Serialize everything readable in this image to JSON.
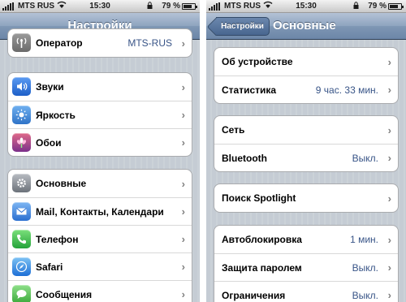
{
  "colors": {
    "value_text": "#385487",
    "nav_bar": "#6c86a8",
    "background": "#c5ccd4"
  },
  "left_screen": {
    "status": {
      "carrier": "MTS RUS",
      "time": "15:30",
      "battery": "79 %",
      "battery_level": 0.79
    },
    "nav": {
      "title": "Настройки"
    },
    "groups": [
      {
        "rows": [
          {
            "icon": "antenna-icon",
            "label": "Оператор",
            "value": "MTS-RUS"
          }
        ]
      },
      {
        "rows": [
          {
            "icon": "speaker-icon",
            "label": "Звуки"
          },
          {
            "icon": "sun-icon",
            "label": "Яркость"
          },
          {
            "icon": "flower-icon",
            "label": "Обои"
          }
        ]
      },
      {
        "rows": [
          {
            "icon": "gear-icon",
            "label": "Основные"
          },
          {
            "icon": "envelope-icon",
            "label": "Mail, Контакты, Календари"
          },
          {
            "icon": "phone-icon",
            "label": "Телефон"
          },
          {
            "icon": "compass-icon",
            "label": "Safari"
          },
          {
            "icon": "chat-bubble-icon",
            "label": "Сообщения"
          }
        ]
      }
    ]
  },
  "right_screen": {
    "status": {
      "carrier": "MTS RUS",
      "time": "15:30",
      "battery": "79 %",
      "battery_level": 0.79
    },
    "nav": {
      "back_label": "Настройки",
      "title": "Основные"
    },
    "groups": [
      {
        "rows": [
          {
            "label": "Об устройстве"
          },
          {
            "label": "Статистика",
            "value": "9 час. 33 мин."
          }
        ]
      },
      {
        "rows": [
          {
            "label": "Сеть"
          },
          {
            "label": "Bluetooth",
            "value": "Выкл."
          }
        ]
      },
      {
        "rows": [
          {
            "label": "Поиск Spotlight"
          }
        ]
      },
      {
        "rows": [
          {
            "label": "Автоблокировка",
            "value": "1 мин."
          },
          {
            "label": "Защита паролем",
            "value": "Выкл."
          },
          {
            "label": "Ограничения",
            "value": "Выкл."
          }
        ]
      }
    ]
  }
}
